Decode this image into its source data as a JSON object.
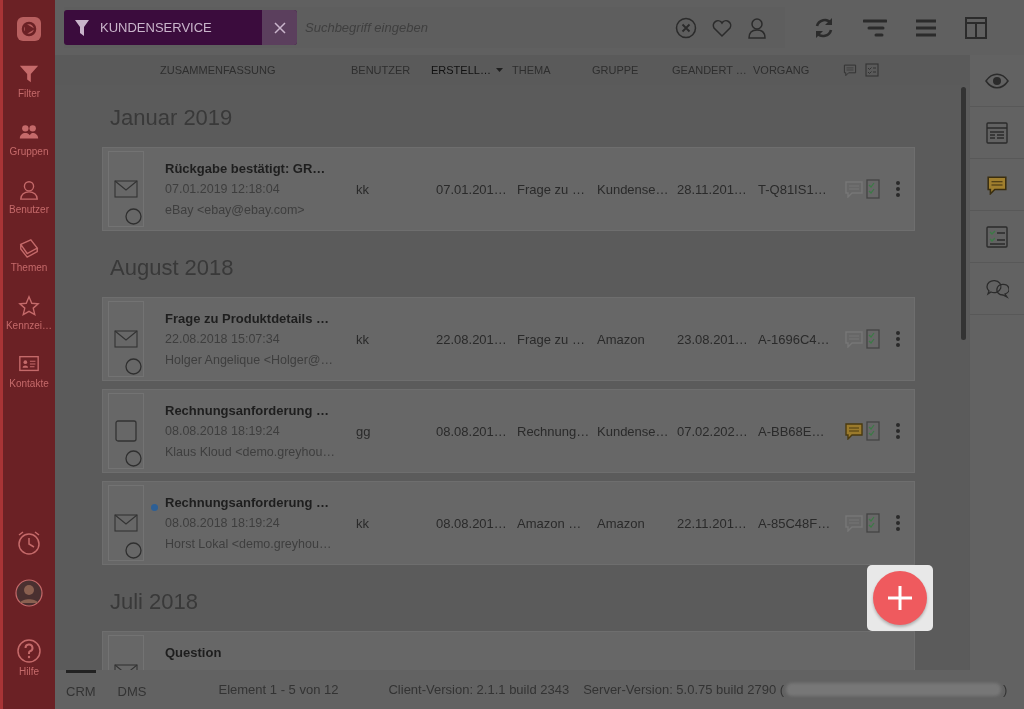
{
  "sidebar": {
    "items": [
      {
        "label": "Filter"
      },
      {
        "label": "Gruppen"
      },
      {
        "label": "Benutzer"
      },
      {
        "label": "Themen"
      },
      {
        "label": "Kennzei…"
      },
      {
        "label": "Kontakte"
      }
    ],
    "help": {
      "label": "Hilfe"
    }
  },
  "top_bar": {
    "filter_chip": {
      "label": "KUNDENSERVICE"
    },
    "search": {
      "placeholder": "Suchbegriff eingeben"
    }
  },
  "columns": [
    {
      "label": "ZUSAMMENFASSUNG",
      "sorted": false
    },
    {
      "label": "BENUTZER",
      "sorted": false
    },
    {
      "label": "ERSTELL…",
      "sorted": true
    },
    {
      "label": "THEMA",
      "sorted": false
    },
    {
      "label": "GRUPPE",
      "sorted": false
    },
    {
      "label": "GEANDERT …",
      "sorted": false
    },
    {
      "label": "VORGANG",
      "sorted": false
    }
  ],
  "groups": [
    {
      "heading": "Januar 2019",
      "items": [
        {
          "kind": "mail",
          "unread": false,
          "title": "Rückgabe bestätigt: GR…",
          "date": "07.01.2019 12:18:04",
          "sender": "eBay <ebay@ebay.com>",
          "user": "kk",
          "created": "07.01.201…",
          "topic": "Frage zu …",
          "group": "Kundense…",
          "changed": "28.11.201…",
          "process": "T-Q81IS1…",
          "has_comment": false
        }
      ]
    },
    {
      "heading": "August 2018",
      "items": [
        {
          "kind": "mail",
          "unread": false,
          "title": "Frage zu Produktdetails …",
          "date": "22.08.2018 15:07:34",
          "sender": "Holger Angelique <Holger@…",
          "user": "kk",
          "created": "22.08.201…",
          "topic": "Frage zu …",
          "group": "Amazon",
          "changed": "23.08.201…",
          "process": "A-1696C4…",
          "has_comment": false
        },
        {
          "kind": "note",
          "unread": false,
          "title": "Rechnungsanforderung …",
          "date": "08.08.2018 18:19:24",
          "sender": "Klaus Kloud <demo.greyhou…",
          "user": "gg",
          "created": "08.08.201…",
          "topic": "Rechnung…",
          "group": "Kundense…",
          "changed": "07.02.202…",
          "process": "A-BB68E…",
          "has_comment": true
        },
        {
          "kind": "mail",
          "unread": true,
          "title": "Rechnungsanforderung …",
          "date": "08.08.2018 18:19:24",
          "sender": "Horst Lokal <demo.greyhou…",
          "user": "kk",
          "created": "08.08.201…",
          "topic": "Amazon …",
          "group": "Amazon",
          "changed": "22.11.201…",
          "process": "A-85C48F…",
          "has_comment": false
        }
      ]
    },
    {
      "heading": "Juli 2018",
      "items": [
        {
          "kind": "mail",
          "unread": false,
          "title": "Question"
        }
      ]
    }
  ],
  "status_bar": {
    "tabs": [
      {
        "label": "CRM",
        "selected": true
      },
      {
        "label": "DMS",
        "selected": false
      }
    ],
    "count": "Element 1 - 5 von 12",
    "client_version": "Client-Version: 2.1.1 build 2343",
    "server_version": "Server-Version: 5.0.75 build 2790 (",
    "server_version_end": ")"
  }
}
